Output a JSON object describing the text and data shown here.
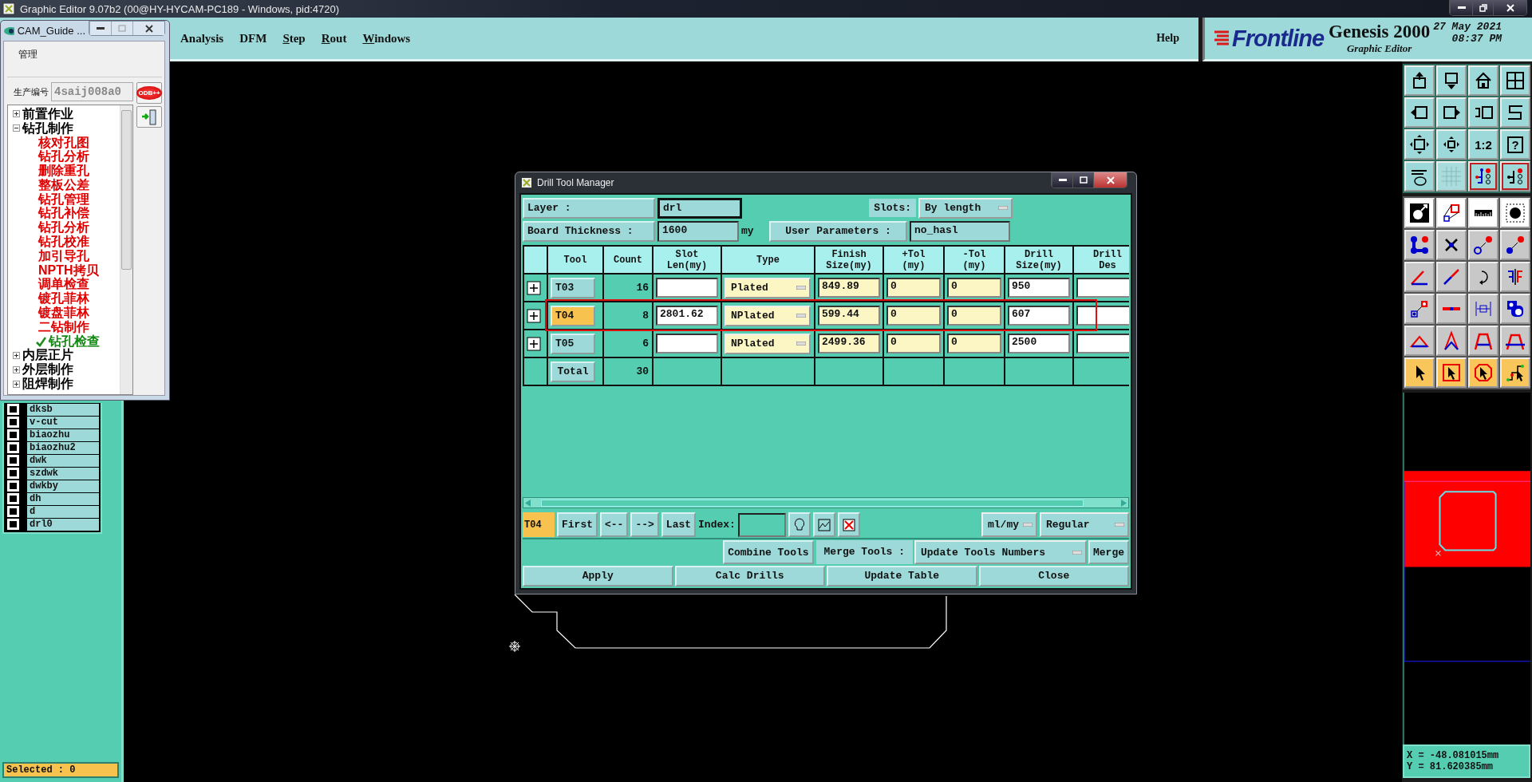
{
  "main_window": {
    "title": "Graphic Editor 9.07b2 (00@HY-HYCAM-PC189 - Windows, pid:4720)"
  },
  "menu": [
    {
      "label": "Analysis",
      "mnemonic": false
    },
    {
      "label": "DFM",
      "mnemonic": false
    },
    {
      "label": "Step",
      "mnemonic": true
    },
    {
      "label": "Rout",
      "mnemonic": true
    },
    {
      "label": "Windows",
      "mnemonic": true
    }
  ],
  "help": "Help",
  "brand": {
    "logo": "Frontline",
    "product": "Genesis 2000",
    "subtitle": "Graphic Editor",
    "date": "27 May 2021",
    "time": "08:37 PM"
  },
  "toolbar_texts": {
    "ratio": "1:2",
    "help": "?"
  },
  "layers": [
    {
      "name": "dksb",
      "checked": false
    },
    {
      "name": "v-cut",
      "checked": false
    },
    {
      "name": "biaozhu",
      "checked": false
    },
    {
      "name": "biaozhu2",
      "checked": false
    },
    {
      "name": "dwk",
      "checked": false
    },
    {
      "name": "szdwk",
      "checked": false
    },
    {
      "name": "dwkby",
      "checked": false
    },
    {
      "name": "dh",
      "checked": false
    },
    {
      "name": "d",
      "checked": false
    },
    {
      "name": "drl0",
      "checked": false
    }
  ],
  "status": "Selected : 0",
  "coordinates": {
    "x": "X = -48.081015mm",
    "y": "Y = 81.620385mm"
  },
  "cam_guide": {
    "title": "CAM_Guide ...",
    "menu": "管理",
    "job_label": "生产编号",
    "job_value": "4saij008a0",
    "odb_button": "ODB++",
    "tree": [
      {
        "label": "前置作业",
        "expanded": false
      },
      {
        "label": "钻孔制作",
        "expanded": true,
        "children": [
          {
            "label": "核对孔图",
            "done": false
          },
          {
            "label": "钻孔分析",
            "done": false
          },
          {
            "label": "删除重孔",
            "done": false
          },
          {
            "label": "整板公差",
            "done": false
          },
          {
            "label": "钻孔管理",
            "done": false
          },
          {
            "label": "钻孔补偿",
            "done": false
          },
          {
            "label": "钻孔分析",
            "done": false
          },
          {
            "label": "钻孔校准",
            "done": false
          },
          {
            "label": "加引导孔",
            "done": false
          },
          {
            "label": "NPTH拷贝",
            "done": false
          },
          {
            "label": "调单检查",
            "done": false
          },
          {
            "label": "镀孔菲林",
            "done": false
          },
          {
            "label": "镀盘菲林",
            "done": false
          },
          {
            "label": "二钻制作",
            "done": false
          },
          {
            "label": "钻孔检查",
            "done": true
          }
        ]
      },
      {
        "label": "内层正片",
        "expanded": false
      },
      {
        "label": "外层制作",
        "expanded": false
      },
      {
        "label": "阻焊制作",
        "expanded": false
      }
    ]
  },
  "drill_tool_manager": {
    "title": "Drill Tool Manager",
    "layer_label": "Layer :",
    "layer_value": "drl",
    "slots_label": "Slots:",
    "slots_value": "By length",
    "thickness_label": "Board Thickness :",
    "thickness_value": "1600",
    "thickness_unit": "my",
    "user_params_button": "User Parameters :",
    "user_params_value": "no_hasl",
    "columns": [
      "Tool",
      "Count",
      "Slot\nLen(my)",
      "Type",
      "Finish\nSize(my)",
      "+Tol\n(my)",
      "-Tol\n(my)",
      "Drill\nSize(my)",
      "Drill\nDes"
    ],
    "rows": [
      {
        "tool": "T03",
        "count": "16",
        "type": "Plated",
        "finish": "849.89",
        "plus_tol": "0",
        "minus_tol": "0",
        "drill_size": "950",
        "selected": false,
        "highlighted": false
      },
      {
        "tool": "T04",
        "count": "8",
        "slot_len": "2801.62",
        "type": "NPlated",
        "finish": "599.44",
        "plus_tol": "0",
        "minus_tol": "0",
        "drill_size": "607",
        "selected": true,
        "highlighted": true
      },
      {
        "tool": "T05",
        "count": "6",
        "type": "NPlated",
        "finish": "2499.36",
        "plus_tol": "0",
        "minus_tol": "0",
        "drill_size": "2500",
        "selected": false,
        "highlighted": false
      }
    ],
    "total": {
      "label": "Total",
      "count": "30"
    },
    "current_tool": "T04",
    "nav_buttons": [
      "First",
      "<--",
      "-->",
      "Last"
    ],
    "index_label": "Index:",
    "units": "ml/my",
    "mode": "Regular",
    "combine_button": "Combine Tools",
    "merge_label": "Merge Tools :",
    "merge_option": "Update Tools Numbers",
    "merge_button": "Merge",
    "actions": [
      "Apply",
      "Calc Drills",
      "Update Table",
      "Close"
    ]
  }
}
